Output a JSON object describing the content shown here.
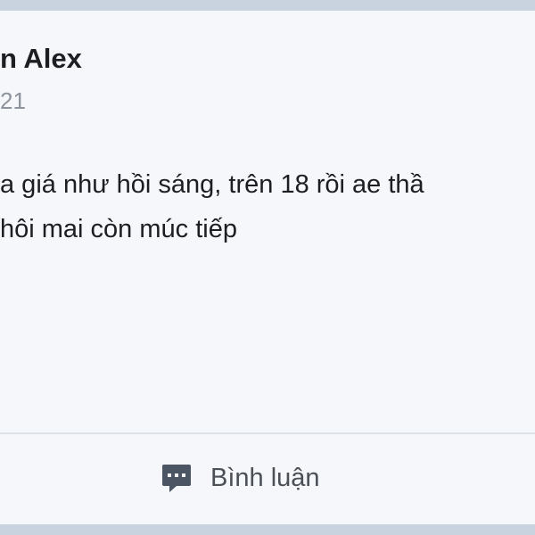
{
  "post": {
    "author": "n Alex",
    "time": "21",
    "body_lines": [
      "a giá như hồi sáng, trên 18 rồi ae thầ",
      "hôi mai còn múc tiếp"
    ]
  },
  "actions": {
    "comment_label": "Bình luận",
    "comment_icon": "comment-icon"
  },
  "colors": {
    "frame": "#c9d3e0",
    "card": "#f5f7fa",
    "icon": "#4b5563"
  }
}
